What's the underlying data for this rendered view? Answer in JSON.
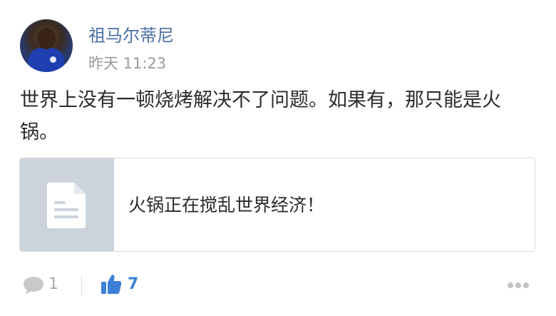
{
  "post": {
    "author": "祖马尔蒂尼",
    "timestamp": "昨天 11:23",
    "text": "世界上没有一顿烧烤解决不了问题。如果有，那只能是火锅。"
  },
  "link_card": {
    "title": "火锅正在搅乱世界经济！",
    "thumbnail_icon": "document-icon"
  },
  "footer": {
    "comment_count": "1",
    "like_count": "7",
    "comment_icon": "comment-icon",
    "like_icon": "thumbs-up-icon",
    "more_icon": "more-icon"
  },
  "colors": {
    "author": "#4a6fa5",
    "like_active": "#3d7fd6",
    "muted": "#a8a8a8",
    "thumb_bg": "#ccd3db"
  }
}
